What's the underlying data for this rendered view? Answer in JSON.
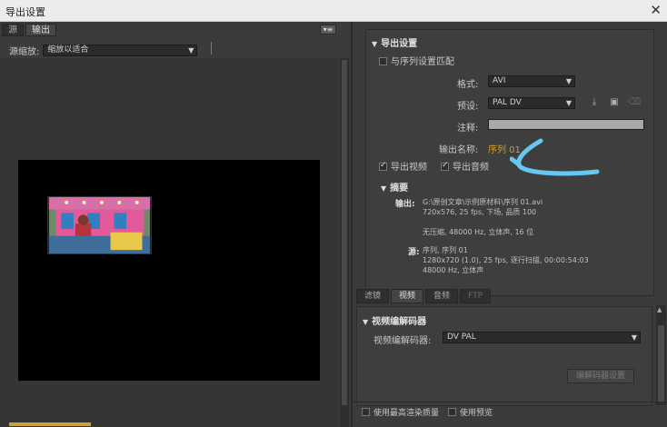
{
  "window": {
    "title": "导出设置",
    "close_icon": "close-icon"
  },
  "left": {
    "tabs": [
      "源",
      "输出"
    ],
    "active_tab": 1,
    "scale_label": "源缩放:",
    "scale_value": "缩放以适合"
  },
  "export": {
    "section_title": "导出设置",
    "match_sequence": "与序列设置匹配",
    "match_sequence_checked": false,
    "format_label": "格式:",
    "format_value": "AVI",
    "preset_label": "预设:",
    "preset_value": "PAL DV",
    "comment_label": "注释:",
    "comment_value": "",
    "output_name_label": "输出名称:",
    "output_name_value": "序列 01",
    "export_video": "导出视频",
    "export_video_checked": true,
    "export_audio": "导出音频",
    "export_audio_checked": true
  },
  "summary": {
    "title": "摘要",
    "output_label": "输出:",
    "output_lines": [
      "G:\\原创文章\\示例原材料\\序列 01.avi",
      "720x576, 25 fps, 下场, 品质 100",
      "",
      "无压缩, 48000 Hz, 立体声, 16 位"
    ],
    "source_label": "源:",
    "source_lines": [
      "序列, 序列 01",
      "1280x720 (1.0), 25 fps, 逐行扫描, 00:00:54:03",
      "48000 Hz, 立体声"
    ]
  },
  "right_tabs": [
    "滤镜",
    "视频",
    "音频",
    "FTP"
  ],
  "active_right_tab": 1,
  "video": {
    "section_title": "视频编解码器",
    "codec_label": "视频编解码器:",
    "codec_value": "DV PAL",
    "codec_settings_button": "编解码器设置"
  },
  "bottom": {
    "max_render": "使用最高渲染质量",
    "use_preview": "使用预览"
  },
  "colors": {
    "accent_orange": "#d0a030",
    "annotation_arrow": "#66c8f0"
  }
}
